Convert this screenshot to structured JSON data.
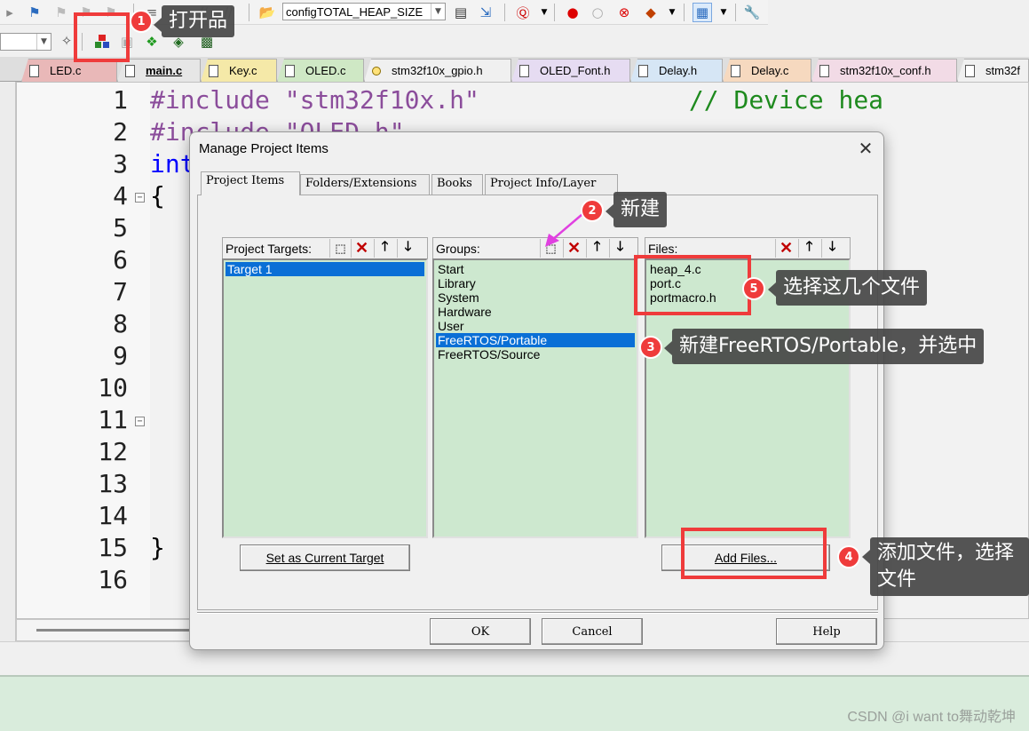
{
  "toolbar": {
    "heap_config_combo": "configTOTAL_HEAP_SIZE"
  },
  "file_tabs": [
    {
      "label": "LED.c",
      "color": "#e9b8b8"
    },
    {
      "label": "main.c",
      "color": "#e6e6e6"
    },
    {
      "label": "Key.c",
      "color": "#f5e9a8"
    },
    {
      "label": "OLED.c",
      "color": "#cfe8c5"
    },
    {
      "label": "stm32f10x_gpio.h",
      "color": "#f0f0f0"
    },
    {
      "label": "OLED_Font.h",
      "color": "#e6dcf2"
    },
    {
      "label": "Delay.h",
      "color": "#d6e6f5"
    },
    {
      "label": "Delay.c",
      "color": "#f6d9bf"
    },
    {
      "label": "stm32f10x_conf.h",
      "color": "#f2dbe6"
    },
    {
      "label": "stm32f",
      "color": "#f0f0f0"
    }
  ],
  "editor": {
    "line_numbers": [
      "1",
      "2",
      "3",
      "4",
      "5",
      "6",
      "7",
      "8",
      "9",
      "10",
      "11",
      "12",
      "13",
      "14",
      "15",
      "16"
    ],
    "code": {
      "l1_directive": "#include",
      "l1_string": "\"stm32f10x.h\"",
      "l1_comment": "// Device hea",
      "l2_directive": "#include",
      "l2_string": "\"OLED.h\"",
      "l3_keyword": "int",
      "l4_brace": "{",
      "l15_brace": "}"
    }
  },
  "dialog": {
    "title": "Manage Project Items",
    "close_glyph": "✕",
    "tabs": [
      "Project Items",
      "Folders/Extensions",
      "Books",
      "Project Info/Layer"
    ],
    "targets": {
      "label": "Project Targets:",
      "items": [
        "Target 1"
      ]
    },
    "groups": {
      "label": "Groups:",
      "items": [
        "Start",
        "Library",
        "System",
        "Hardware",
        "User",
        "FreeRTOS/Portable",
        "FreeRTOS/Source"
      ],
      "selected": "FreeRTOS/Portable"
    },
    "files": {
      "label": "Files:",
      "items": [
        "heap_4.c",
        "port.c",
        "portmacro.h"
      ]
    },
    "buttons": {
      "set_current_target": "Set as Current Target",
      "add_files": "Add Files...",
      "ok": "OK",
      "cancel": "Cancel",
      "help": "Help"
    }
  },
  "annotations": [
    {
      "num": "1",
      "text": "打开品"
    },
    {
      "num": "2",
      "text": "新建"
    },
    {
      "num": "3",
      "text": "新建FreeRTOS/Portable，并选中"
    },
    {
      "num": "4",
      "text": "添加文件，选择文件"
    },
    {
      "num": "5",
      "text": "选择这几个文件"
    }
  ],
  "watermark": "CSDN @i want to舞动乾坤",
  "colors": {
    "accent_red": "#ef3b3b",
    "list_green": "#cde8cf",
    "selection_blue": "#0a6fd6",
    "arrow_magenta": "#e040e0"
  }
}
